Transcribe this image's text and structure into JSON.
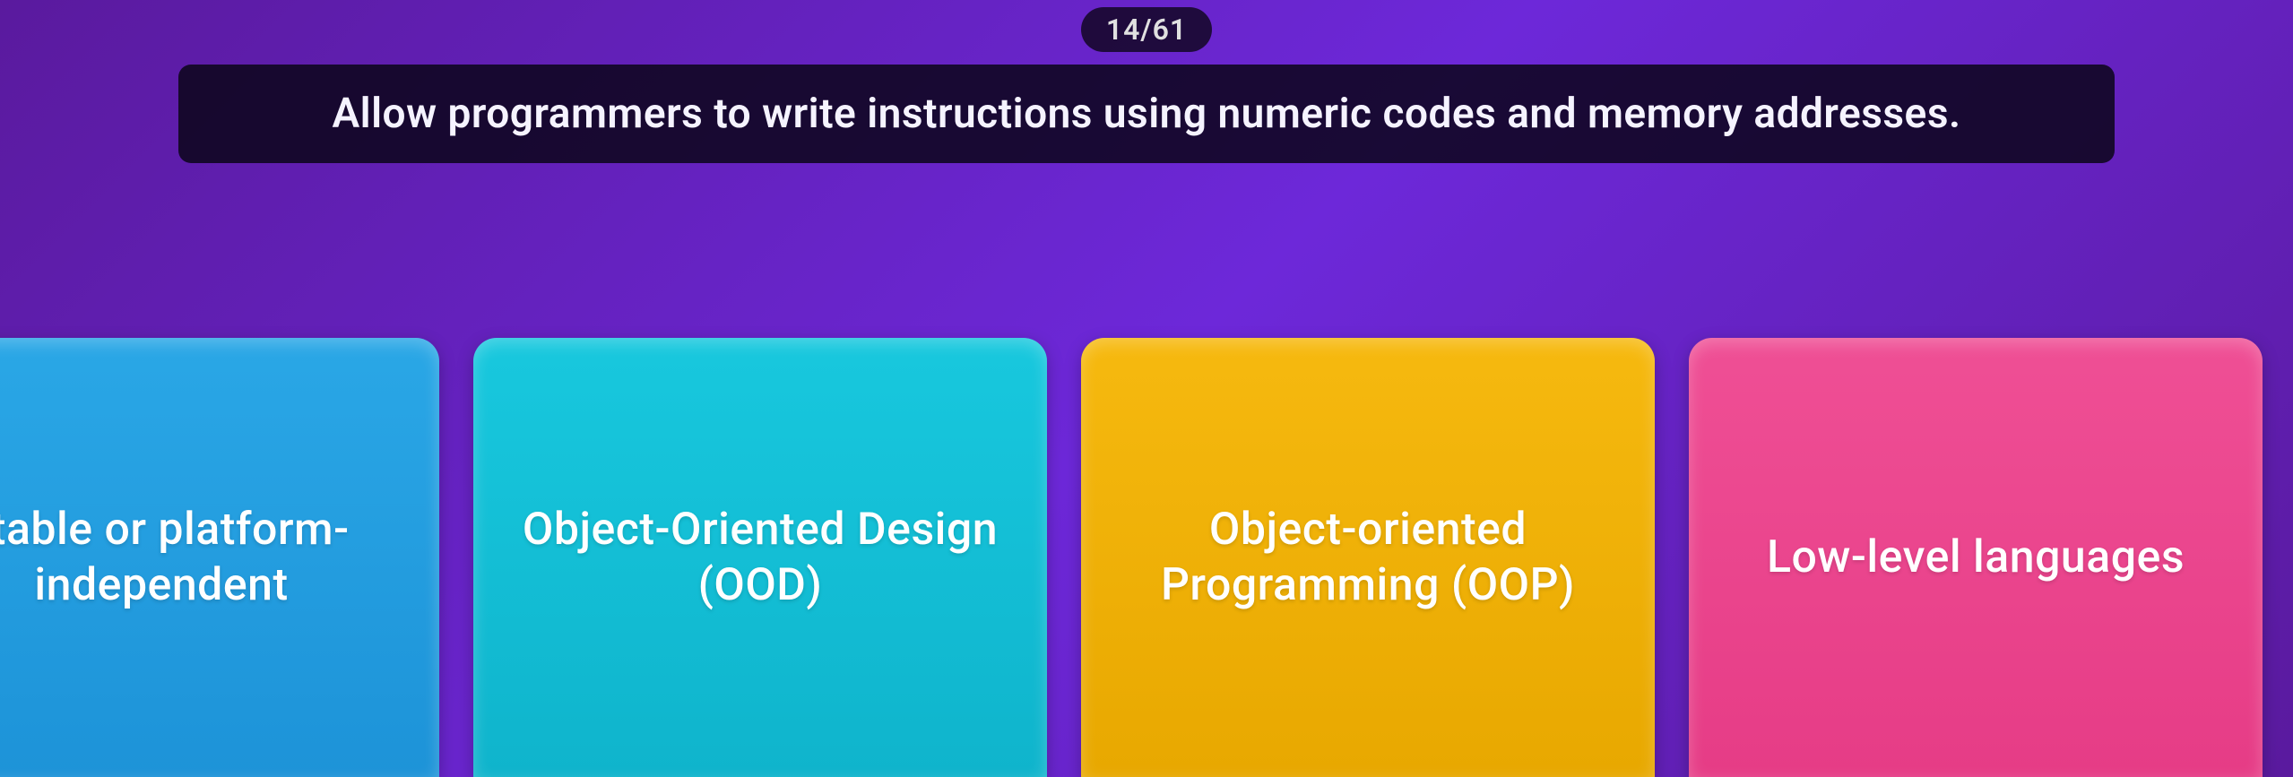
{
  "progress": {
    "label": "14/61",
    "current": 14,
    "total": 61
  },
  "question": {
    "text": "Allow programmers to write instructions using numeric codes and memory addresses."
  },
  "answers": [
    {
      "label": "rtable or platform-independent",
      "color": "blue"
    },
    {
      "label": "Object-Oriented Design (OOD)",
      "color": "cyan"
    },
    {
      "label": "Object-oriented Programming (OOP)",
      "color": "orange"
    },
    {
      "label": "Low-level languages",
      "color": "pink"
    }
  ]
}
